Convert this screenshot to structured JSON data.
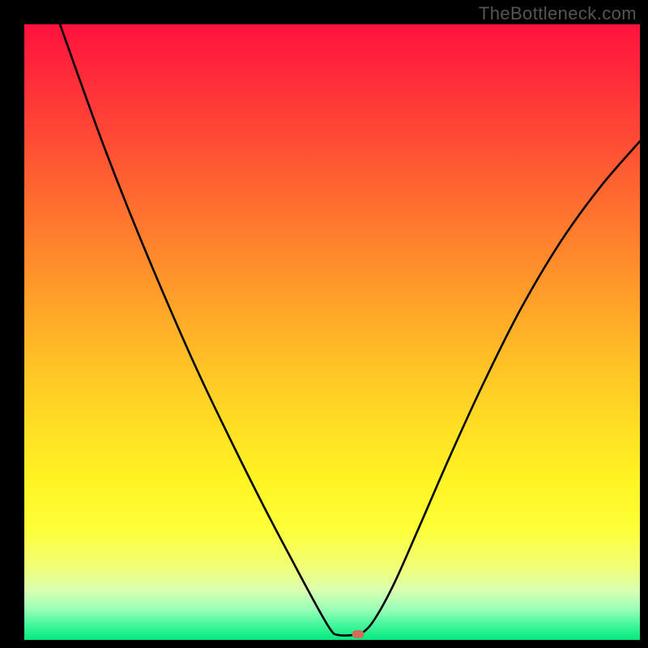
{
  "watermark": "TheBottleneck.com",
  "chart_data": {
    "type": "line",
    "title": "",
    "xlabel": "",
    "ylabel": "",
    "xlim": [
      0,
      100
    ],
    "ylim": [
      0,
      100
    ],
    "grid": false,
    "legend": false,
    "background": "red-yellow-green vertical gradient",
    "curve_points": [
      {
        "x": 5.8,
        "y": 100.0
      },
      {
        "x": 9.0,
        "y": 91.0
      },
      {
        "x": 13.0,
        "y": 80.0
      },
      {
        "x": 17.5,
        "y": 68.5
      },
      {
        "x": 22.5,
        "y": 56.5
      },
      {
        "x": 28.0,
        "y": 44.0
      },
      {
        "x": 33.5,
        "y": 32.5
      },
      {
        "x": 39.0,
        "y": 21.5
      },
      {
        "x": 44.0,
        "y": 12.0
      },
      {
        "x": 47.5,
        "y": 5.5
      },
      {
        "x": 49.8,
        "y": 1.6
      },
      {
        "x": 51.0,
        "y": 0.8
      },
      {
        "x": 53.5,
        "y": 0.8
      },
      {
        "x": 55.0,
        "y": 1.2
      },
      {
        "x": 57.0,
        "y": 3.5
      },
      {
        "x": 60.0,
        "y": 9.0
      },
      {
        "x": 64.0,
        "y": 18.0
      },
      {
        "x": 69.0,
        "y": 29.5
      },
      {
        "x": 74.5,
        "y": 41.5
      },
      {
        "x": 80.5,
        "y": 53.5
      },
      {
        "x": 87.0,
        "y": 64.5
      },
      {
        "x": 93.5,
        "y": 73.5
      },
      {
        "x": 100.0,
        "y": 81.0
      }
    ],
    "marker": {
      "x": 54.2,
      "y": 0.9,
      "color": "#cf6c5a"
    },
    "gradient_stops": [
      {
        "pos": 0,
        "color": "#ff123d"
      },
      {
        "pos": 0.5,
        "color": "#ffc726"
      },
      {
        "pos": 0.82,
        "color": "#fdff38"
      },
      {
        "pos": 1.0,
        "color": "#04e87f"
      }
    ]
  }
}
